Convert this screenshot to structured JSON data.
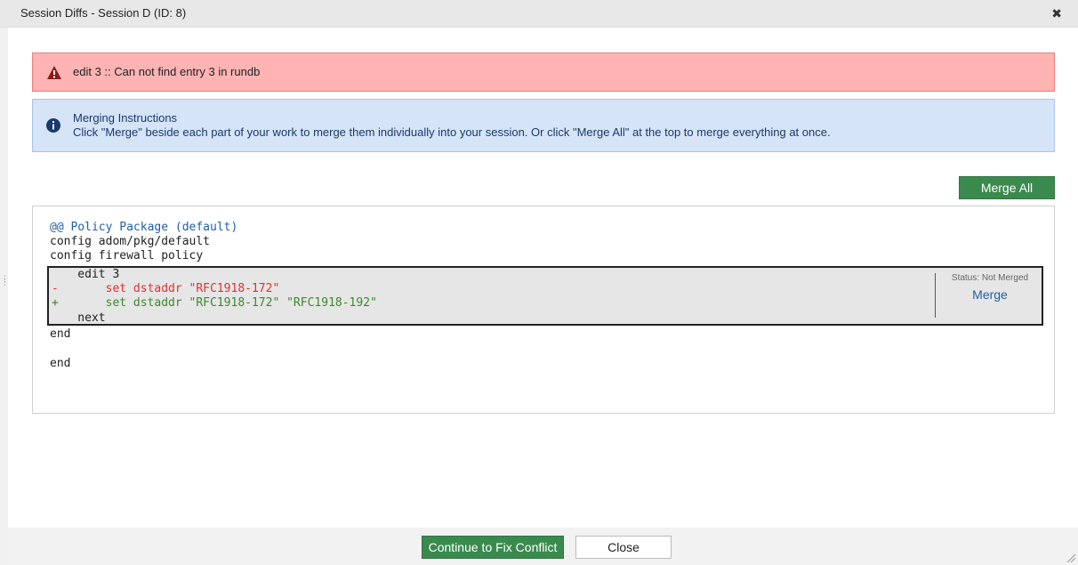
{
  "window": {
    "title": "Session Diffs - Session D (ID: 8)",
    "close_glyph": "✖"
  },
  "error_alert": {
    "icon": "warning-triangle-icon",
    "message": "edit 3 :: Can not find entry 3 in rundb",
    "color": "#ffb3b3"
  },
  "info_alert": {
    "icon": "info-circle-icon",
    "heading": "Merging Instructions",
    "body": "Click \"Merge\" beside each part of your work to merge them individually into your session. Or click \"Merge All\" at the top to merge everything at once.",
    "color": "#d5e4f7"
  },
  "toolbar": {
    "merge_all_label": "Merge All"
  },
  "diff": {
    "header": "@@ Policy Package (default)",
    "pre_lines": [
      "config adom/pkg/default",
      "config firewall policy"
    ],
    "hunk": {
      "context_before": "    edit 3",
      "removed_marker": "-",
      "removed_line": "        set dstaddr \"RFC1918-172\"",
      "added_marker": "+",
      "added_line": "        set dstaddr \"RFC1918-172\" \"RFC1918-192\"",
      "context_after": "    next",
      "status_label": "Status: Not Merged",
      "merge_label": "Merge"
    },
    "post_lines": [
      "end",
      "end"
    ]
  },
  "footer": {
    "continue_label": "Continue to Fix Conflict",
    "close_label": "Close"
  },
  "colors": {
    "accent_green": "#3a8a4e",
    "link_blue": "#2060a8",
    "removed_red": "#e03030",
    "added_green": "#3a8a2a"
  }
}
